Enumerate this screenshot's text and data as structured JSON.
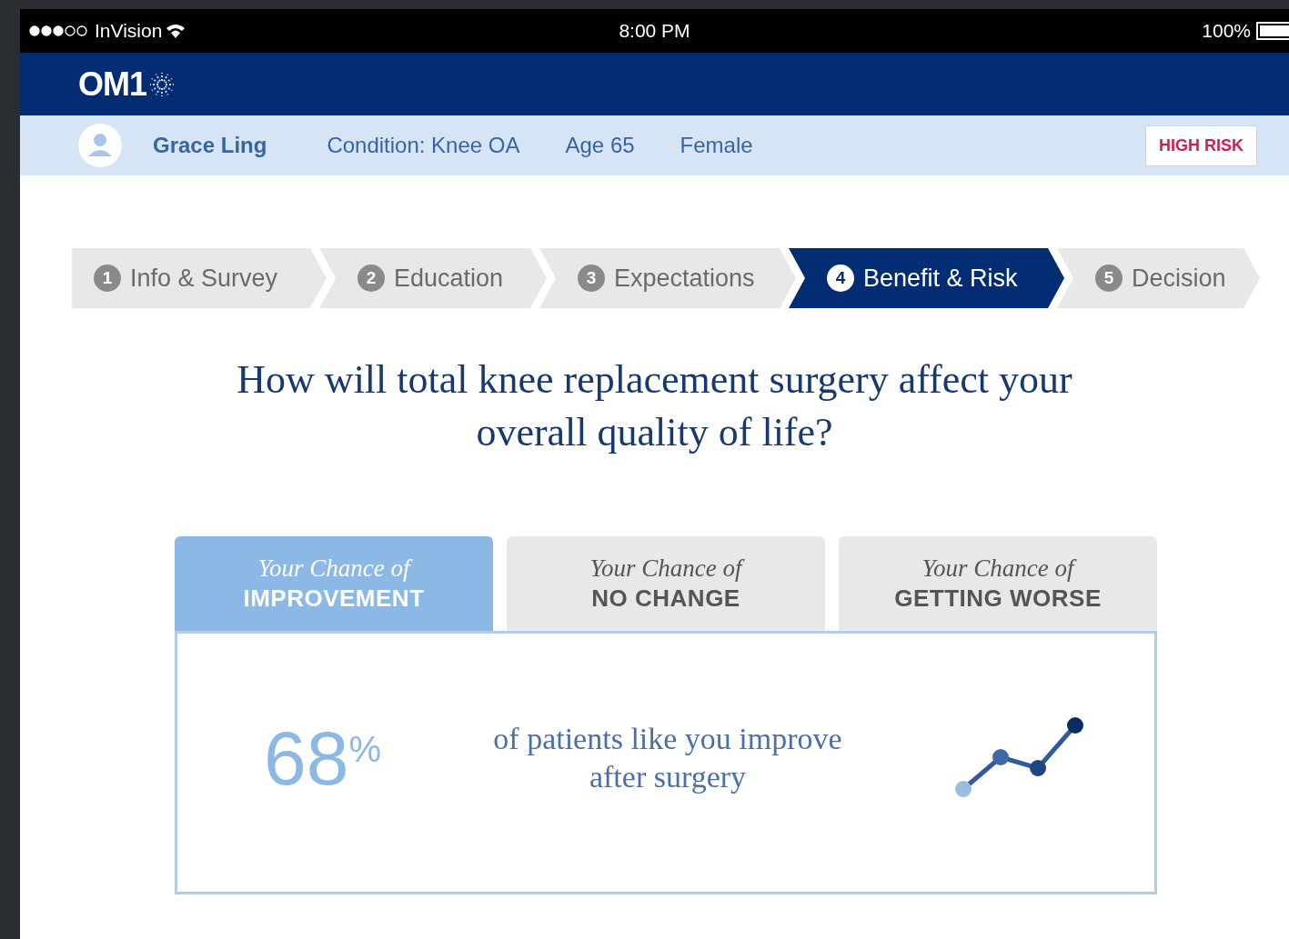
{
  "status_bar": {
    "carrier": "InVision",
    "time": "8:00 PM",
    "battery": "100%"
  },
  "header": {
    "logo": "OM1"
  },
  "patient": {
    "name": "Grace Ling",
    "condition": "Condition: Knee OA",
    "age": "Age 65",
    "sex": "Female",
    "risk_badge": "HIGH RISK"
  },
  "steps": [
    {
      "number": "1",
      "label": "Info & Survey",
      "selected": false
    },
    {
      "number": "2",
      "label": "Education",
      "selected": false
    },
    {
      "number": "3",
      "label": "Expectations",
      "selected": false
    },
    {
      "number": "4",
      "label": "Benefit & Risk",
      "selected": true
    },
    {
      "number": "5",
      "label": "Decision",
      "selected": false
    }
  ],
  "question": "How will total knee replacement surgery affect your overall quality of life?",
  "outcome_tabs": [
    {
      "prefix": "Your Chance of",
      "label": "IMPROVEMENT",
      "selected": true
    },
    {
      "prefix": "Your Chance of",
      "label": "NO CHANGE",
      "selected": false
    },
    {
      "prefix": "Your Chance of",
      "label": "GETTING WORSE",
      "selected": false
    }
  ],
  "result": {
    "value": "68",
    "unit": "%",
    "description": "of patients like you improve after surgery"
  }
}
